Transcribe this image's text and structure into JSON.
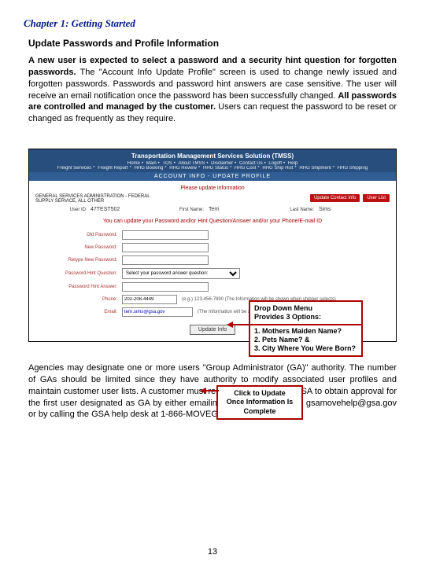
{
  "chapter_title": "Chapter 1:  Getting Started",
  "section_title": "Update Passwords and Profile Information",
  "paragraph1_a": "A new user is expected to select a password and a security hint question for forgotten passwords.",
  "paragraph1_b": "  The \"Account Info Update Profile\" screen is used to change newly issued and forgotten passwords.  Passwords and password hint answers are case sensitive.    The user will receive an email notification once the password has been successfully changed.  ",
  "paragraph1_c": "All passwords are controlled and managed by the customer.",
  "paragraph1_d": "  Users can request the password to be reset or changed as frequently as they require.",
  "paragraph2": "Agencies may designate one or more users  \"Group Administrator (GA)\" authority. The number of GAs should be limited since they have authority to modify associated user profiles and maintain customer user lists.  A customer must receive approval from GSA to obtain approval for the first user designated as GA by either emailing a request to GSA at gsamovehelp@gsa.gov or by calling the GSA help desk at 1-866-MOVEGSA.",
  "screenshot": {
    "app_title": "Transportation Management Services Solution (TMSS)",
    "nav1": [
      "Home",
      "Main",
      "TOS",
      "About TMSS",
      "Disclaimer",
      "Contact Us",
      "Logoff",
      "Help"
    ],
    "nav2": [
      "Freight Services",
      "Freight Report",
      "HHG Booking",
      "HHG Review",
      "HHG Status",
      "HHG Cost",
      "HHG Ship Hist",
      "HHG Shipment",
      "HHG Shipping"
    ],
    "band": "ACCOUNT INFO - UPDATE PROFILE",
    "please": "Please update information",
    "agency1": "GENERAL SERVICES ADMINISTRATION - FEDERAL",
    "agency2": "SUPPLY SERVICE, ALL OTHER",
    "btn_update_contact": "Update Contact Info",
    "btn_user_list": "User List",
    "userid_label": "User ID",
    "userid_value": "47TEST502",
    "firstname_label": "First Name:",
    "firstname_value": "Terri",
    "lastname_label": "Last Name:",
    "lastname_value": "Sims",
    "warn_line": "You can update your Password and/or Hint Question/Answer and/or your Phone/E-mail ID",
    "labels": {
      "old_password": "Old Password:",
      "new_password": "New Password:",
      "retype_password": "Retype New Password:",
      "hint_question": "Password Hint Question:",
      "hint_answer": "Password Hint Answer:",
      "phone": "Phone:",
      "email": "Email:"
    },
    "hint_select": "Select your password answer question:",
    "phone_value": "202-208-4449",
    "phone_hint": "(e.g.) 123-456-7890 (The Information will be shown when shipper selects)",
    "email_value": "terri.sims@gsa.gov",
    "email_hint": "(The Information will be shown when shipper selects)",
    "update_btn": "Update Info"
  },
  "callout1": {
    "l1": "Drop Down Menu",
    "l2": "Provides 3 Options:",
    "l3": "1. Mothers Maiden Name?",
    "l4": "2. Pets Name? &",
    "l5": "3. City Where You  Were Born?"
  },
  "callout2": {
    "l1": "Click to Update",
    "l2": "Once Information Is",
    "l3": "Complete"
  },
  "page_number": "13"
}
